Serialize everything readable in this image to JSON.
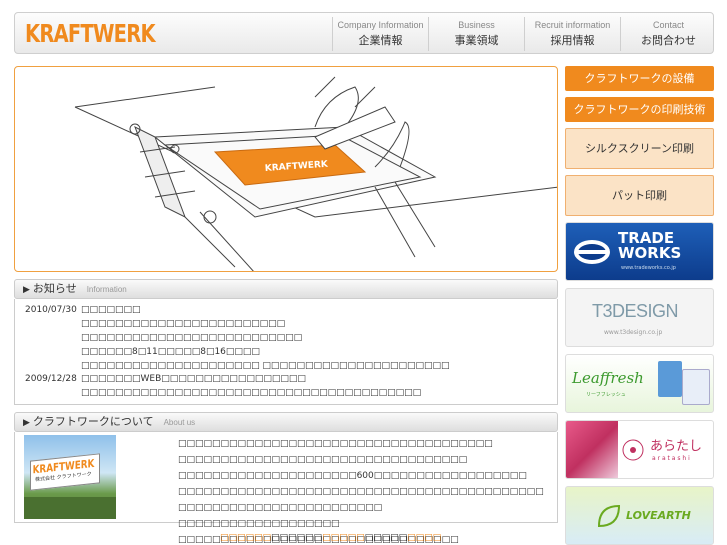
{
  "header": {
    "logo": "KRAFTWERK",
    "nav": [
      {
        "en": "Company Information",
        "ja": "企業情報"
      },
      {
        "en": "Business",
        "ja": "事業領域"
      },
      {
        "en": "Recruit information",
        "ja": "採用情報"
      },
      {
        "en": "Contact",
        "ja": "お問合わせ"
      }
    ]
  },
  "hero": {
    "screen_logo": "KRAFTWERK"
  },
  "sidebar": {
    "buttons": [
      {
        "label": "クラフトワークの設備"
      },
      {
        "label": "クラフトワークの印刷技術"
      }
    ],
    "cream_buttons": [
      {
        "label": "シルクスクリーン印刷"
      },
      {
        "label": "パット印刷"
      }
    ],
    "banners": {
      "trade_works": {
        "line1": "TRADE",
        "line2": "WORKS",
        "url": "www.tradeworks.co.jp"
      },
      "t3design": {
        "name": "T3DESIGN",
        "url": "www.t3design.co.jp"
      },
      "leaffresh": {
        "name": "Leaffresh",
        "kana": "リーフフレッシュ"
      },
      "aratashi": {
        "name": "あらたし",
        "roman": "a r a t a s h i"
      },
      "loveearth": {
        "name": "LOVEARTH"
      }
    }
  },
  "news": {
    "title": "お知らせ",
    "subtitle": "Information",
    "items": [
      {
        "date": "2010/07/30",
        "lines": [
          "□□□□□□□",
          "□□□□□□□□□□□□□□□□□□□□□□□□ □□□□□□□□□□□□□□□□□□□□□□□□□□",
          "□□□□□□8□11□□□□□8□16□□□□",
          "□□□□□□□□□□□□□□□□□□□□□ □□□□□□□□□□□□□□□□□□□□□□"
        ]
      },
      {
        "date": "2009/12/28",
        "lines": [
          "□□□□□□□WEB□□□□□□□□□□□□□□□□□",
          "□□□□□□□□□□□□□□□□□□□□□□□□□□□□□□□□□□□□□□□□"
        ]
      }
    ]
  },
  "about": {
    "title": "クラフトワークについて",
    "subtitle": "About us",
    "sign_text": "KRAFTWERK",
    "sign_sub": "株式会社 クラフトワーク",
    "lines": [
      "□□□□□□□□□□□□□□□□□□□□□□□□□□□□□□□□□□□□□",
      "□□□□□□□□□□□□□□□□□□□□□□□□□□□□□□□□□□",
      "□□□□□□□□□□□□□□□□□□□□□600□□□□□□□□□□□□□□□□□□",
      "□□□□□□□□□□□□□□□□□□□□□□□□□□□□□□□□□□□□□□□□□□□",
      "□□□□□□□□□□□□□□□□□□□□□□□□ □□□□□□□□□□□□□□□□□□□",
      "□□□□□□□□□□□□□□□□□□□□□□□□□□□□□□□□□"
    ]
  },
  "footer": {
    "parts": [
      {
        "text": "□□□□□□",
        "orange": true
      },
      {
        "text": "□□□□□□",
        "orange": false
      },
      {
        "text": "□□□□□",
        "orange": true
      },
      {
        "text": "□□□□□",
        "orange": false
      },
      {
        "text": "□□□□",
        "orange": true
      }
    ]
  },
  "colors": {
    "accent": "#f08a1e",
    "cream": "#fbe3c6",
    "trade_blue": "#0d3c8c",
    "leaf_green": "#3c9a2e"
  }
}
